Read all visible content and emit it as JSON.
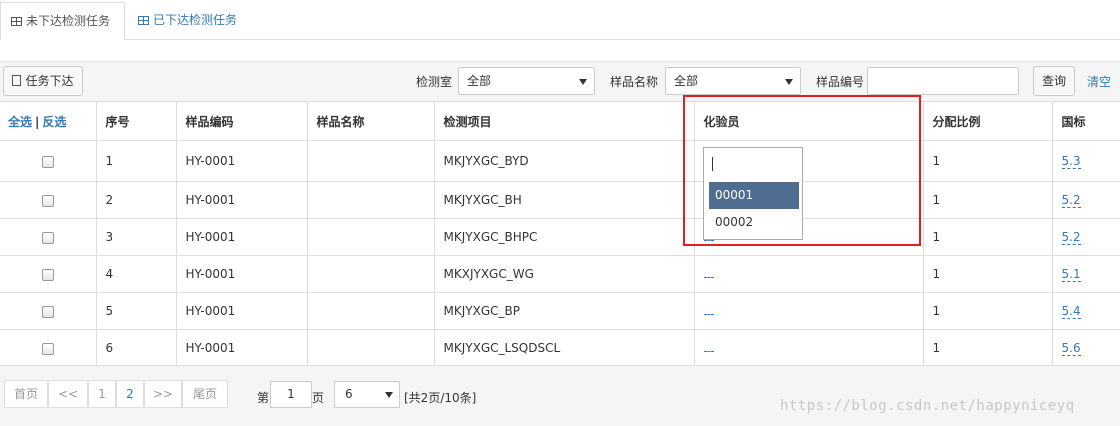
{
  "tabs": [
    {
      "label": "未下达检测任务",
      "active": true
    },
    {
      "label": "已下达检测任务",
      "active": false
    }
  ],
  "toolbar": {
    "assign_label": "任务下达",
    "lab_label": "检测室",
    "lab_value": "全部",
    "sample_name_label": "样品名称",
    "sample_name_value": "全部",
    "sample_code_label": "样品编号",
    "sample_code_value": "",
    "query_label": "查询",
    "clear_label": "清空"
  },
  "table": {
    "select_all": "全选",
    "separator": "|",
    "invert": "反选",
    "headers": [
      "序号",
      "样品编码",
      "样品名称",
      "检测项目",
      "化验员",
      "分配比例",
      "国标"
    ],
    "rows": [
      {
        "no": "1",
        "code": "HY-0001",
        "name": "",
        "item": "MKJYXGC_BYD",
        "ratio": "1",
        "std": "5.3"
      },
      {
        "no": "2",
        "code": "HY-0001",
        "name": "",
        "item": "MKJYXGC_BH",
        "ratio": "1",
        "std": "5.2"
      },
      {
        "no": "3",
        "code": "HY-0001",
        "name": "",
        "item": "MKJYXGC_BHPC",
        "ratio": "1",
        "std": "5.2"
      },
      {
        "no": "4",
        "code": "HY-0001",
        "name": "",
        "item": "MKXJYXGC_WG",
        "ratio": "1",
        "std": "5.1"
      },
      {
        "no": "5",
        "code": "HY-0001",
        "name": "",
        "item": "MKJYXGC_BP",
        "ratio": "1",
        "std": "5.4"
      },
      {
        "no": "6",
        "code": "HY-0001",
        "name": "",
        "item": "MKJYXGC_LSQDSCL",
        "ratio": "1",
        "std": "5.6"
      }
    ]
  },
  "dropdown": {
    "search_value": "",
    "options": [
      "00001",
      "00002"
    ],
    "highlighted": "00001"
  },
  "pager": {
    "first": "首页",
    "prev": "<<",
    "pages": [
      "1",
      "2"
    ],
    "current_page": "2",
    "next": ">>",
    "last": "尾页",
    "goto_prefix": "第",
    "goto_value": "1",
    "goto_suffix": "页",
    "page_size": "6",
    "summary": "[共2页/10条]"
  },
  "watermark": "https://blog.csdn.net/happyniceyq",
  "colors": {
    "link": "#337ab7",
    "highlight": "#4f6d91",
    "annotation": "#e02020"
  }
}
